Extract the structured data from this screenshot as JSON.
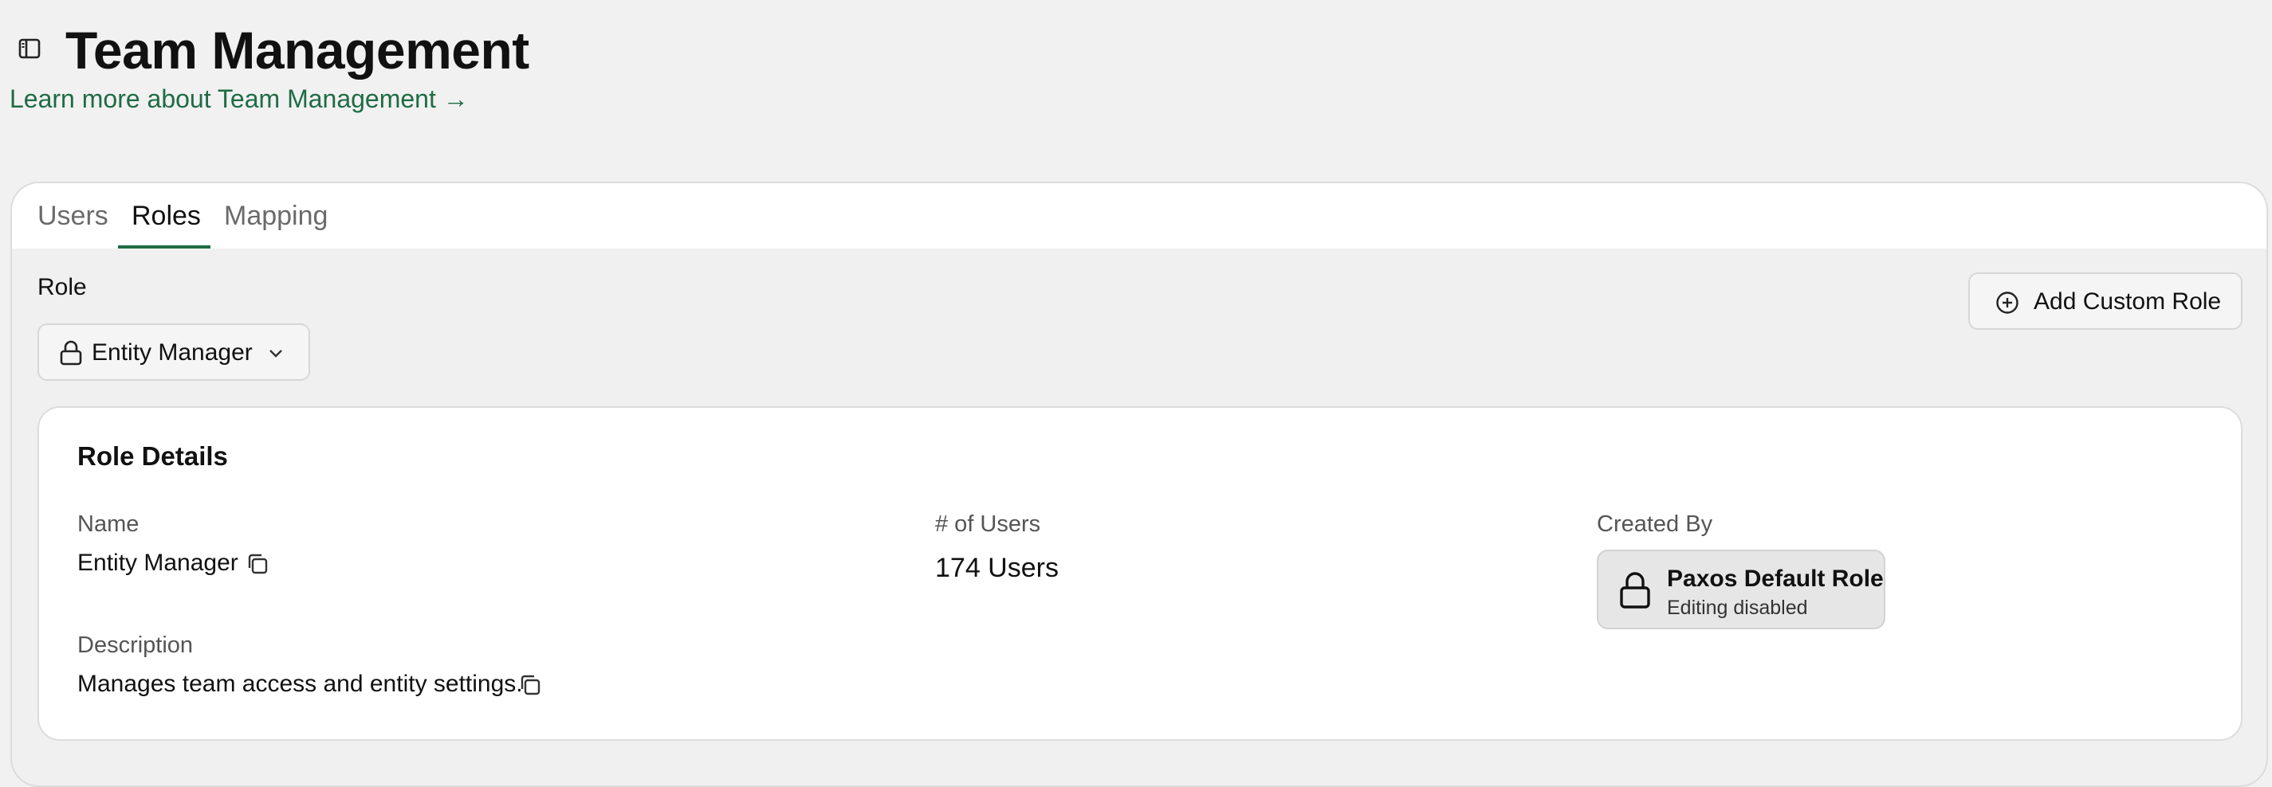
{
  "header": {
    "title": "Team Management",
    "learn_more": "Learn more about Team Management →"
  },
  "tabs": [
    {
      "label": "Users",
      "active": false
    },
    {
      "label": "Roles",
      "active": true
    },
    {
      "label": "Mapping",
      "active": false
    }
  ],
  "role_selector": {
    "label": "Role",
    "selected": "Entity Manager"
  },
  "actions": {
    "add_custom_role": "Add Custom Role"
  },
  "role_details": {
    "title": "Role Details",
    "name_label": "Name",
    "name_value": "Entity Manager",
    "users_label": "# of Users",
    "users_value": "174 Users",
    "created_by_label": "Created By",
    "created_by_title": "Paxos Default Role",
    "created_by_subtitle": "Editing disabled",
    "description_label": "Description",
    "description_value": "Manages team access and entity settings."
  },
  "icons": {
    "sidebar_toggle": "sidebar-toggle-icon",
    "lock": "lock-icon",
    "chevron": "chevron-down-icon",
    "add": "plus-circle-icon",
    "copy": "copy-icon"
  },
  "colors": {
    "accent": "#1f6b45",
    "background": "#f1f1f1",
    "card": "#ffffff"
  }
}
